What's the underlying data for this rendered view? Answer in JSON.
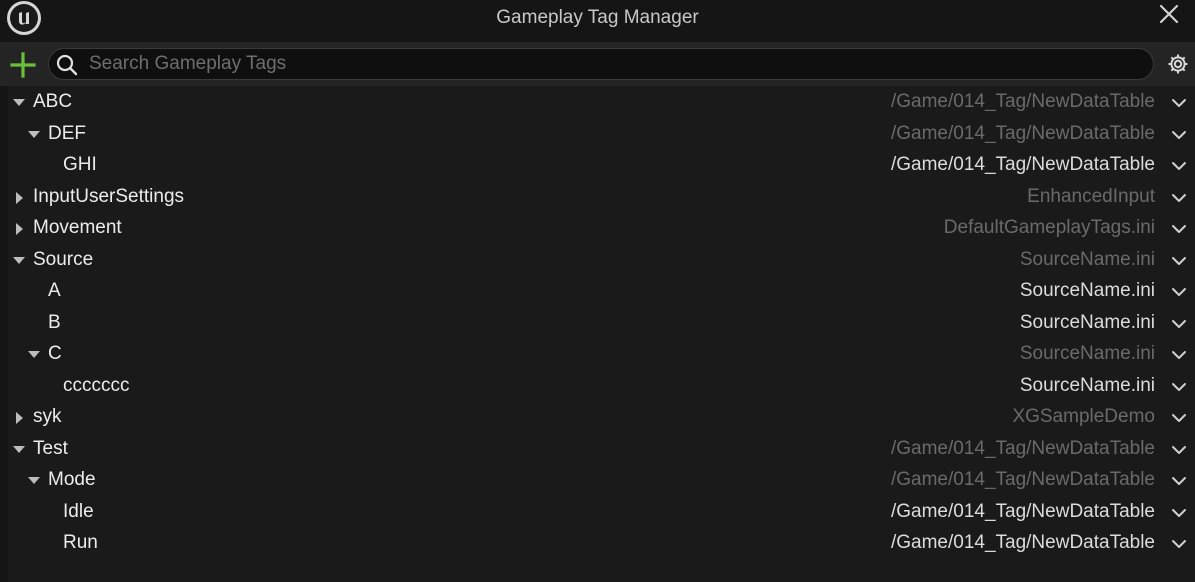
{
  "window": {
    "title": "Gameplay Tag Manager"
  },
  "toolbar": {
    "search_placeholder": "Search Gameplay Tags",
    "search_value": ""
  },
  "icons": {
    "logo": "unreal-engine-logo",
    "close": "close-icon",
    "add": "plus-icon",
    "search": "search-icon",
    "settings": "gear-icon",
    "row_menu": "chevron-down-icon"
  },
  "colors": {
    "add_icon": "#6bbf3a",
    "background": "#151515",
    "tree_background": "#1a1a1a"
  },
  "tree": {
    "rows": [
      {
        "name": "ABC",
        "depth": 0,
        "expander": "expanded",
        "source": "/Game/014_Tag/NewDataTable",
        "source_dim": true
      },
      {
        "name": "DEF",
        "depth": 1,
        "expander": "expanded",
        "source": "/Game/014_Tag/NewDataTable",
        "source_dim": true
      },
      {
        "name": "GHI",
        "depth": 2,
        "expander": "none",
        "source": "/Game/014_Tag/NewDataTable",
        "source_dim": false
      },
      {
        "name": "InputUserSettings",
        "depth": 0,
        "expander": "collapsed",
        "source": "EnhancedInput",
        "source_dim": true
      },
      {
        "name": "Movement",
        "depth": 0,
        "expander": "collapsed",
        "source": "DefaultGameplayTags.ini",
        "source_dim": true
      },
      {
        "name": "Source",
        "depth": 0,
        "expander": "expanded",
        "source": "SourceName.ini",
        "source_dim": true
      },
      {
        "name": "A",
        "depth": 1,
        "expander": "none",
        "source": "SourceName.ini",
        "source_dim": false
      },
      {
        "name": "B",
        "depth": 1,
        "expander": "none",
        "source": "SourceName.ini",
        "source_dim": false
      },
      {
        "name": "C",
        "depth": 1,
        "expander": "expanded",
        "source": "SourceName.ini",
        "source_dim": true
      },
      {
        "name": "ccccccc",
        "depth": 2,
        "expander": "none",
        "source": "SourceName.ini",
        "source_dim": false
      },
      {
        "name": "syk",
        "depth": 0,
        "expander": "collapsed",
        "source": "XGSampleDemo",
        "source_dim": true
      },
      {
        "name": "Test",
        "depth": 0,
        "expander": "expanded",
        "source": "/Game/014_Tag/NewDataTable",
        "source_dim": true
      },
      {
        "name": "Mode",
        "depth": 1,
        "expander": "expanded",
        "source": "/Game/014_Tag/NewDataTable",
        "source_dim": true
      },
      {
        "name": "Idle",
        "depth": 2,
        "expander": "none",
        "source": "/Game/014_Tag/NewDataTable",
        "source_dim": false
      },
      {
        "name": "Run",
        "depth": 2,
        "expander": "none",
        "source": "/Game/014_Tag/NewDataTable",
        "source_dim": false
      }
    ]
  }
}
